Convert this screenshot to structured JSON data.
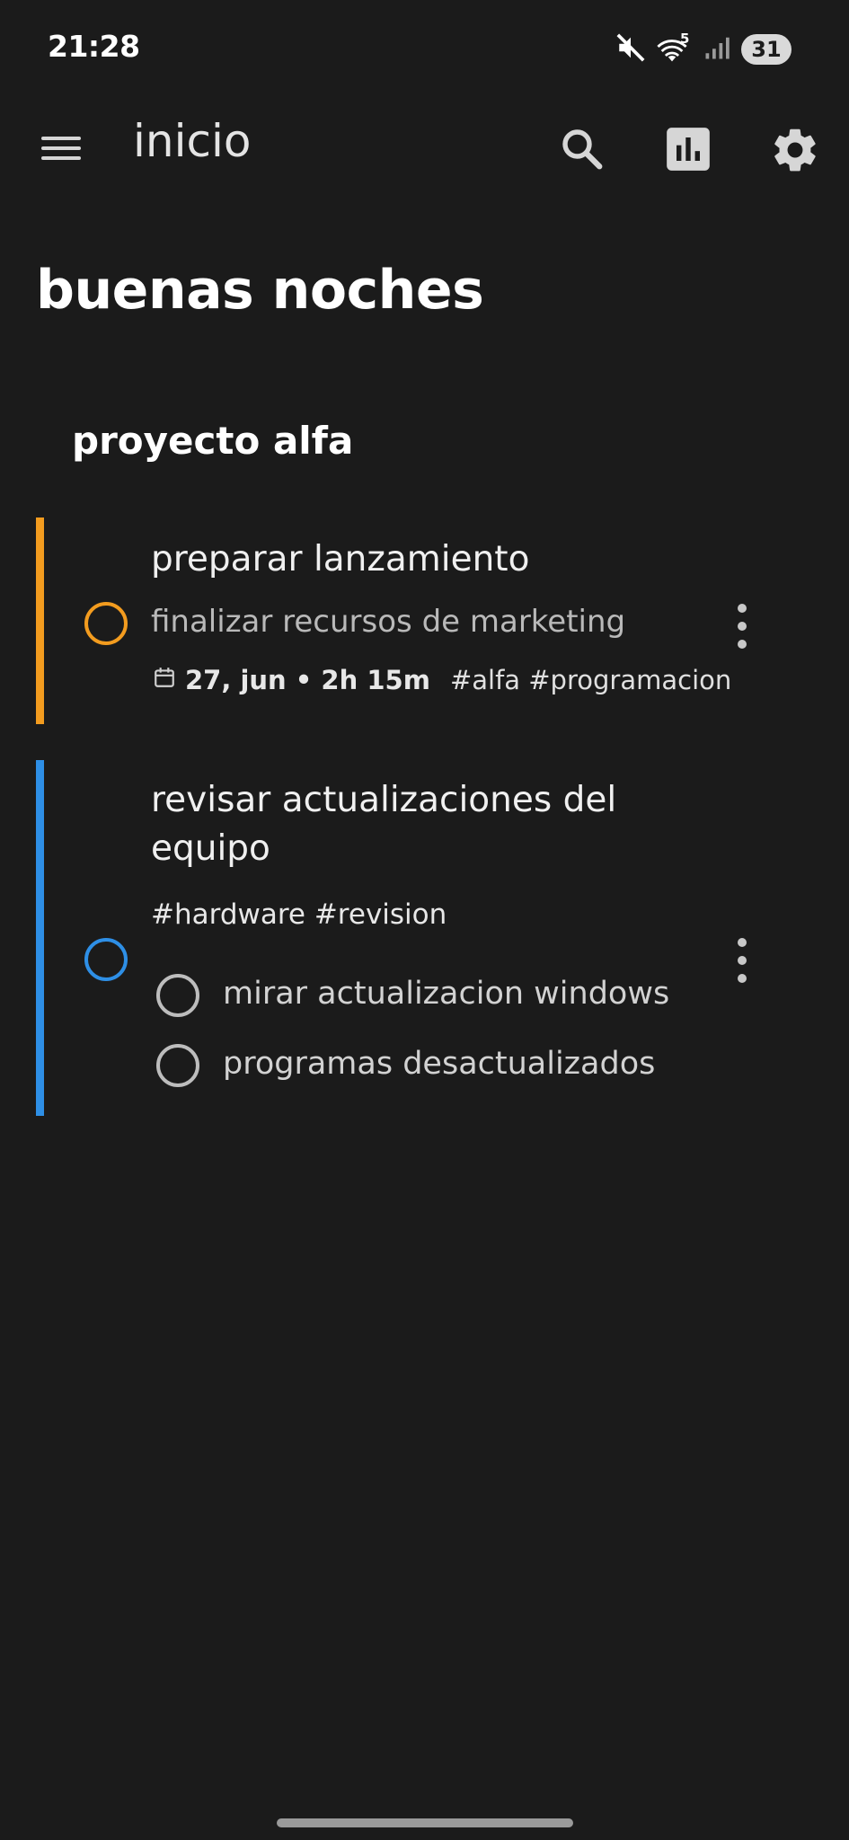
{
  "status_bar": {
    "time": "21:28",
    "battery": "31",
    "wifi_badge": "5"
  },
  "app_bar": {
    "title": "inicio"
  },
  "greeting": "buenas noches",
  "project": {
    "title": "proyecto alfa"
  },
  "tasks": [
    {
      "title": "preparar lanzamiento",
      "subtitle": "finalizar recursos de marketing",
      "date": "27, jun • 2h 15m",
      "tags": "#alfa #programacion",
      "accent": "#f39c1f"
    },
    {
      "title_line1": "revisar actualizaciones del",
      "title_line2": "equipo",
      "tags": "#hardware #revision",
      "accent": "#2e8fe6",
      "subtasks": [
        "mirar actualizacion windows",
        "programas desactualizados"
      ]
    }
  ],
  "colors": {
    "background": "#1b1b1b",
    "orange_accent": "#f39c1f",
    "blue_accent": "#2e8fe6"
  },
  "icons": [
    "mute-icon",
    "wifi-icon",
    "signal-icon",
    "menu-icon",
    "search-icon",
    "stats-icon",
    "settings-icon",
    "calendar-icon",
    "more-vert-icon"
  ]
}
